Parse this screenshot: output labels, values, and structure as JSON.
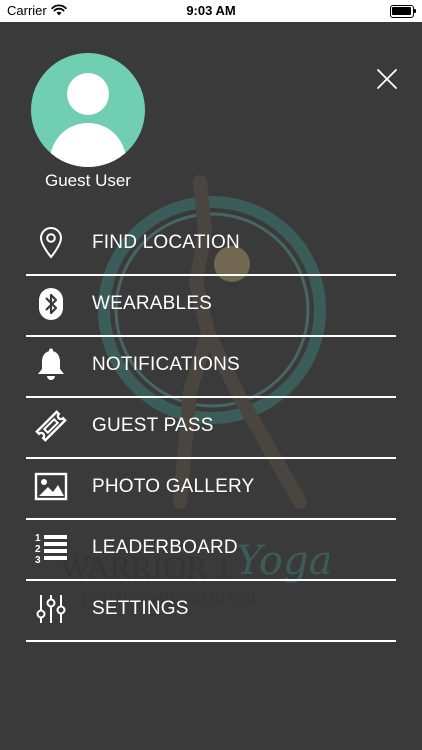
{
  "status_bar": {
    "carrier": "Carrier",
    "time": "9:03 AM"
  },
  "drawer": {
    "background_color": "#3a3a3a",
    "divider_color": "#ffffff",
    "close_icon": "close-icon",
    "user": {
      "name": "Guest User",
      "avatar_color": "#6fcfb0"
    },
    "watermark": {
      "brand_text": "WARRIOR 1",
      "brand_script": "Yoga",
      "tagline": "FIND THE WARRIOR IN YOU"
    },
    "menu": [
      {
        "label": "FIND LOCATION",
        "icon": "location-pin-icon"
      },
      {
        "label": "WEARABLES",
        "icon": "bluetooth-icon"
      },
      {
        "label": "NOTIFICATIONS",
        "icon": "bell-icon"
      },
      {
        "label": "GUEST PASS",
        "icon": "ticket-icon"
      },
      {
        "label": "PHOTO GALLERY",
        "icon": "image-icon"
      },
      {
        "label": "LEADERBOARD",
        "icon": "ranked-list-icon"
      },
      {
        "label": "SETTINGS",
        "icon": "sliders-icon"
      }
    ]
  }
}
